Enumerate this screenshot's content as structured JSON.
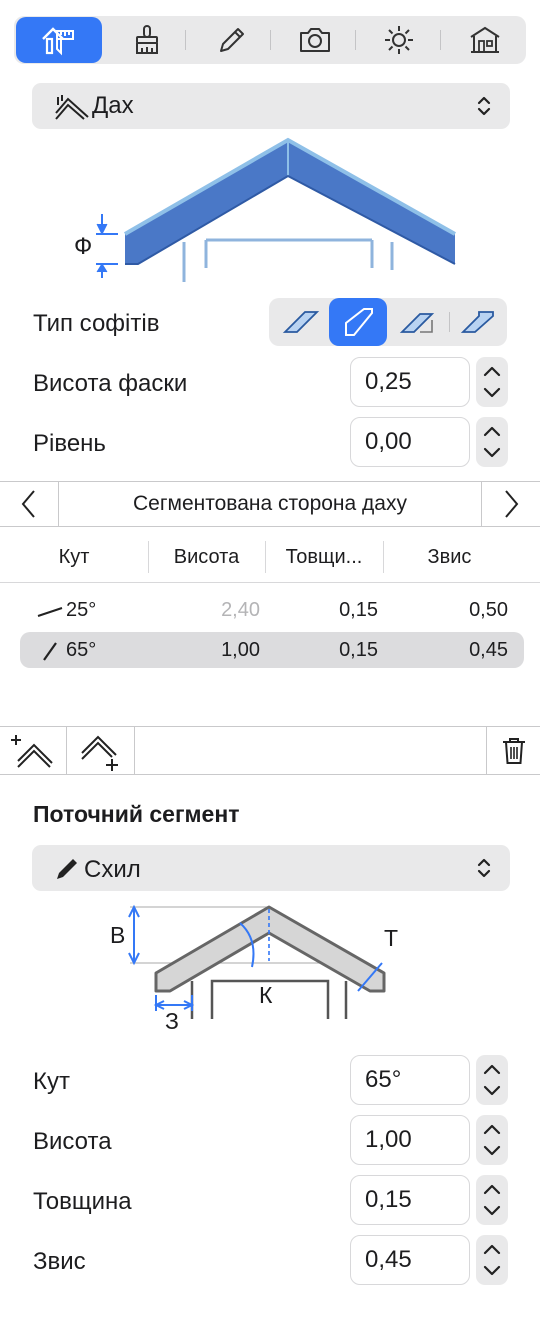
{
  "toolbar": {
    "tabs": [
      {
        "name": "structure-tab",
        "icon": "roof-structure-icon"
      },
      {
        "name": "appearance-tab",
        "icon": "brush-icon"
      },
      {
        "name": "edit-tab",
        "icon": "pencil-icon"
      },
      {
        "name": "camera-tab",
        "icon": "camera-icon"
      },
      {
        "name": "light-tab",
        "icon": "sun-icon"
      },
      {
        "name": "building-tab",
        "icon": "house-icon"
      }
    ],
    "selected_index": 0,
    "accent": "#3478f6"
  },
  "type_popup": {
    "label": "Дах",
    "icon": "roof-icon"
  },
  "roof_diagram": {
    "label": "Ф",
    "fill": "#4a78c7",
    "outline": "#8fc0e8"
  },
  "soffit": {
    "label": "Тип софітів",
    "options": [
      "soffit-type-1-icon",
      "soffit-type-2-icon",
      "soffit-type-3-icon",
      "soffit-type-4-icon"
    ],
    "selected_index": 1
  },
  "fascia_height": {
    "label": "Висота фаски",
    "value": "0,25"
  },
  "level": {
    "label": "Рівень",
    "value": "0,00"
  },
  "segment_nav": {
    "title": "Сегментована сторона даху"
  },
  "table": {
    "columns": [
      "Кут",
      "Висота",
      "Товщи...",
      "Звис"
    ],
    "rows": [
      {
        "angle": "25°",
        "height": "2,40",
        "thickness": "0,15",
        "overhang": "0,50",
        "height_dimmed": true
      },
      {
        "angle": "65°",
        "height": "1,00",
        "thickness": "0,15",
        "overhang": "0,45",
        "selected": true
      }
    ]
  },
  "segment_section": {
    "title": "Поточний сегмент",
    "popup": {
      "label": "Схил",
      "icon": "slope-pencil-icon"
    },
    "diagram_labels": {
      "height": "В",
      "thickness": "Т",
      "angle": "К",
      "overhang": "З"
    },
    "fields": [
      {
        "label": "Кут",
        "value": "65°"
      },
      {
        "label": "Висота",
        "value": "1,00"
      },
      {
        "label": "Товщина",
        "value": "0,15"
      },
      {
        "label": "Звис",
        "value": "0,45"
      }
    ]
  }
}
